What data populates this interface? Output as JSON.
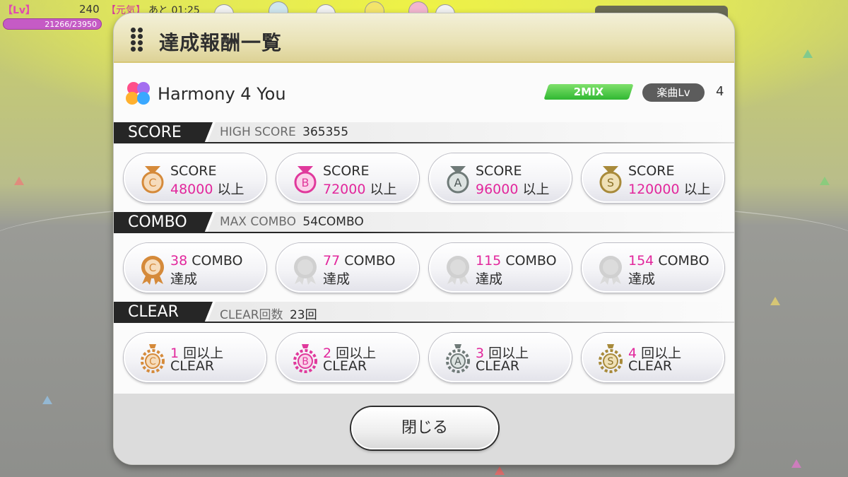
{
  "hud": {
    "lv_tag": "【Lv】",
    "level": "240",
    "genki": "【元気】",
    "time": "あと 01:25",
    "exp": "21266/23950"
  },
  "modal": {
    "title": "達成報酬一覧",
    "song": {
      "title": "Harmony 4 You",
      "mode_badge": "2MIX",
      "level_label": "楽曲Lv",
      "level_value": "4"
    },
    "sections": {
      "score": {
        "label": "SCORE",
        "stat_label": "HIGH SCORE",
        "stat_value": "365355",
        "cards": [
          {
            "rank": "C",
            "line1": "SCORE",
            "value": "48000",
            "suffix": "以上",
            "color": "#d58a3a"
          },
          {
            "rank": "B",
            "line1": "SCORE",
            "value": "72000",
            "suffix": "以上",
            "color": "#e0399c"
          },
          {
            "rank": "A",
            "line1": "SCORE",
            "value": "96000",
            "suffix": "以上",
            "color": "#6f7a78"
          },
          {
            "rank": "S",
            "line1": "SCORE",
            "value": "120000",
            "suffix": "以上",
            "color": "#a88a3a"
          }
        ]
      },
      "combo": {
        "label": "COMBO",
        "stat_label": "MAX COMBO",
        "stat_value": "54COMBO",
        "cards": [
          {
            "rank": "C",
            "value": "38",
            "unit": "COMBO",
            "line2": "達成",
            "achieved": true,
            "color": "#d58a3a"
          },
          {
            "rank": "",
            "value": "77",
            "unit": "COMBO",
            "line2": "達成",
            "achieved": false,
            "color": "#cfcfcf"
          },
          {
            "rank": "",
            "value": "115",
            "unit": "COMBO",
            "line2": "達成",
            "achieved": false,
            "color": "#cfcfcf"
          },
          {
            "rank": "",
            "value": "154",
            "unit": "COMBO",
            "line2": "達成",
            "achieved": false,
            "color": "#cfcfcf"
          }
        ]
      },
      "clear": {
        "label": "CLEAR",
        "stat_label": "CLEAR回数",
        "stat_value": "23回",
        "cards": [
          {
            "rank": "C",
            "value": "1",
            "unit": "回以上",
            "line2": "CLEAR",
            "color": "#d58a3a"
          },
          {
            "rank": "B",
            "value": "2",
            "unit": "回以上",
            "line2": "CLEAR",
            "color": "#e0399c"
          },
          {
            "rank": "A",
            "value": "3",
            "unit": "回以上",
            "line2": "CLEAR",
            "color": "#6f7a78"
          },
          {
            "rank": "S",
            "value": "4",
            "unit": "回以上",
            "line2": "CLEAR",
            "color": "#a88a3a"
          }
        ]
      }
    },
    "close_label": "閉じる"
  }
}
